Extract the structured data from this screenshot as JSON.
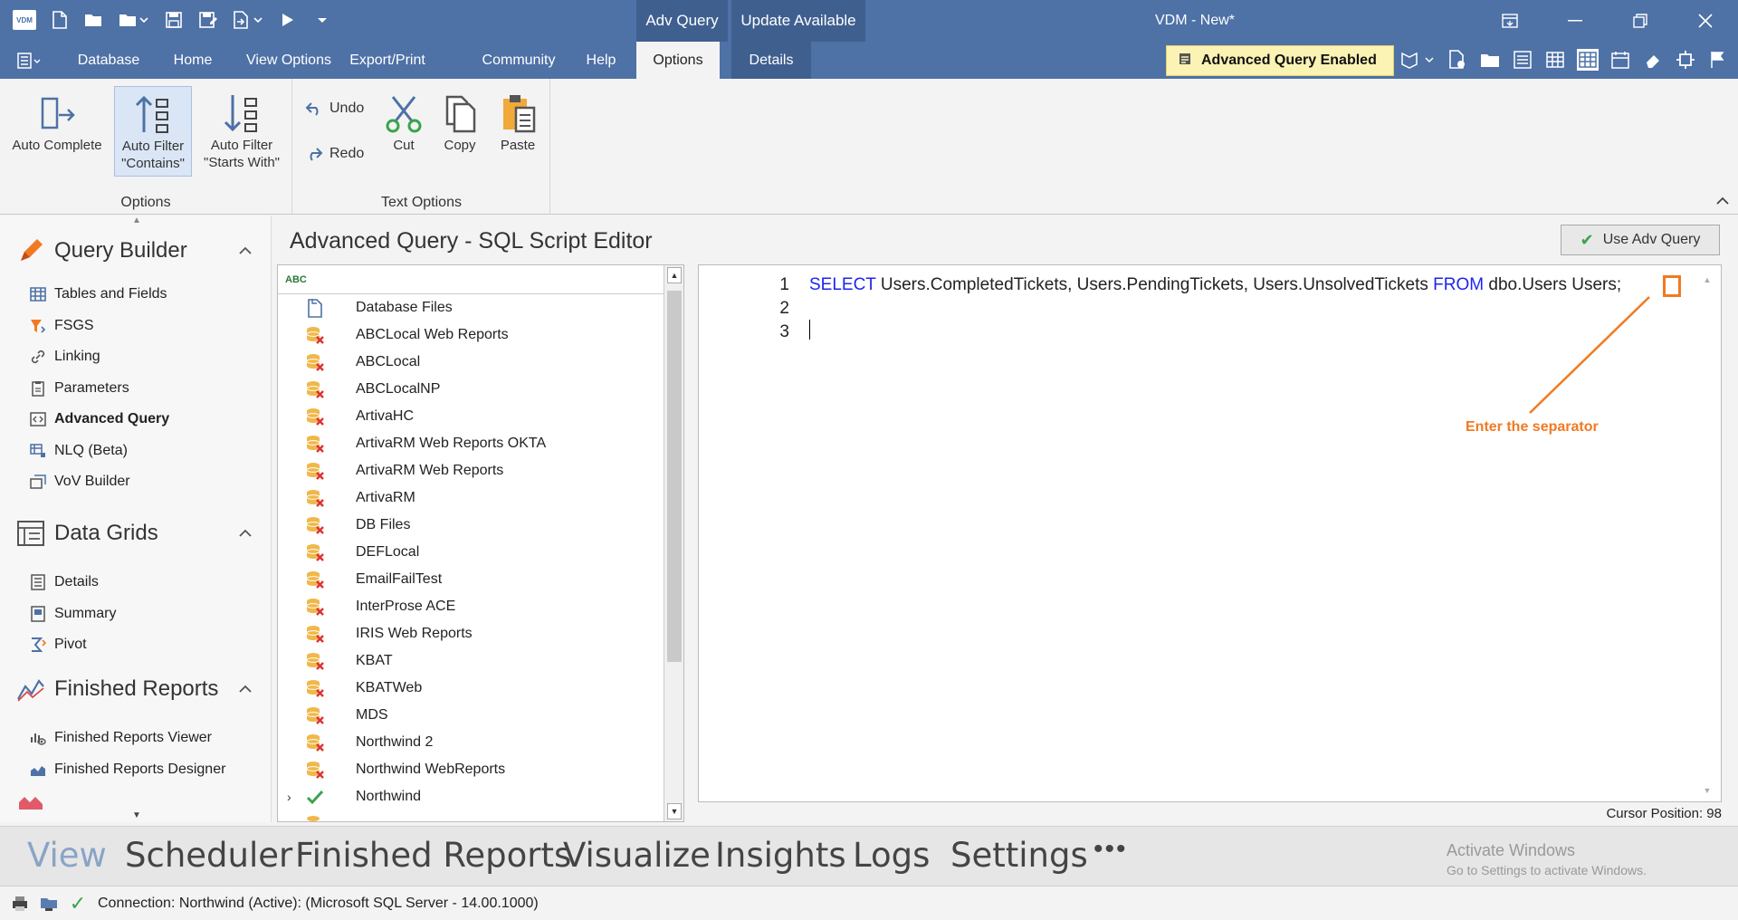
{
  "titlebar": {
    "app_logo": "VDM",
    "context_tabs": [
      "Adv Query",
      "Update Available"
    ],
    "window_title": "VDM - New*",
    "qat_icons": [
      "new-icon",
      "open-icon",
      "open-dropdown-icon",
      "save-icon",
      "save-as-icon",
      "export-icon",
      "run-icon",
      "customize-icon"
    ]
  },
  "ribbon_tabs": [
    "Database",
    "Home",
    "View Options",
    "Export/Print",
    "Community",
    "Help",
    "Options",
    "Details"
  ],
  "active_tab": "Options",
  "advanced_query_badge": "Advanced Query Enabled",
  "ribbon": {
    "options_group": {
      "name": "Options",
      "auto_complete": "Auto Complete",
      "auto_filter_contains_1": "Auto Filter",
      "auto_filter_contains_2": "\"Contains\"",
      "auto_filter_starts_1": "Auto Filter",
      "auto_filter_starts_2": "\"Starts With\""
    },
    "text_options_group": {
      "name": "Text Options",
      "undo": "Undo",
      "redo": "Redo",
      "cut": "Cut",
      "copy": "Copy",
      "paste": "Paste"
    }
  },
  "leftnav": {
    "query_builder": {
      "title": "Query Builder",
      "items": [
        "Tables and Fields",
        "FSGS",
        "Linking",
        "Parameters",
        "Advanced Query",
        "NLQ (Beta)",
        "VoV Builder"
      ]
    },
    "data_grids": {
      "title": "Data Grids",
      "items": [
        "Details",
        "Summary",
        "Pivot"
      ]
    },
    "finished_reports": {
      "title": "Finished Reports",
      "items": [
        "Finished Reports Viewer",
        "Finished Reports Designer"
      ]
    }
  },
  "main": {
    "title": "Advanced Query - SQL Script Editor",
    "use_adv_query_button": "Use Adv Query",
    "tree_header": "ABC",
    "tree_items": [
      "Database Files",
      "ABCLocal Web Reports",
      "ABCLocal",
      "ABCLocalNP",
      "ArtivaHC",
      "ArtivaRM Web Reports OKTA",
      "ArtivaRM Web Reports",
      "ArtivaRM",
      "DB Files",
      "DEFLocal",
      "EmailFailTest",
      "InterProse ACE",
      "IRIS Web Reports",
      "KBAT",
      "KBATWeb",
      "MDS",
      "Northwind 2",
      "Northwind WebReports",
      "Northwind"
    ],
    "editor": {
      "line_numbers": [
        "1",
        "2",
        "3"
      ],
      "kw_select": "SELECT",
      "code_fields": " Users.CompletedTickets, Users.PendingTickets, Users.UnsolvedTickets ",
      "kw_from": "FROM",
      "code_table": " dbo.Users Users;",
      "annotation": "Enter the separator"
    },
    "cursor_position": "Cursor Position: 98"
  },
  "modules": [
    "View",
    "Scheduler",
    "Finished Reports",
    "Visualize",
    "Insights",
    "Logs",
    "Settings"
  ],
  "modules_more": "•••",
  "activate_windows": {
    "line1": "Activate Windows",
    "line2": "Go to Settings to activate Windows."
  },
  "status": {
    "connection": "Connection: Northwind (Active): (Microsoft SQL Server - 14.00.1000)"
  },
  "colors": {
    "accent": "#4e71a6",
    "annotation": "#f07a22",
    "keyword": "#1c24f0"
  }
}
